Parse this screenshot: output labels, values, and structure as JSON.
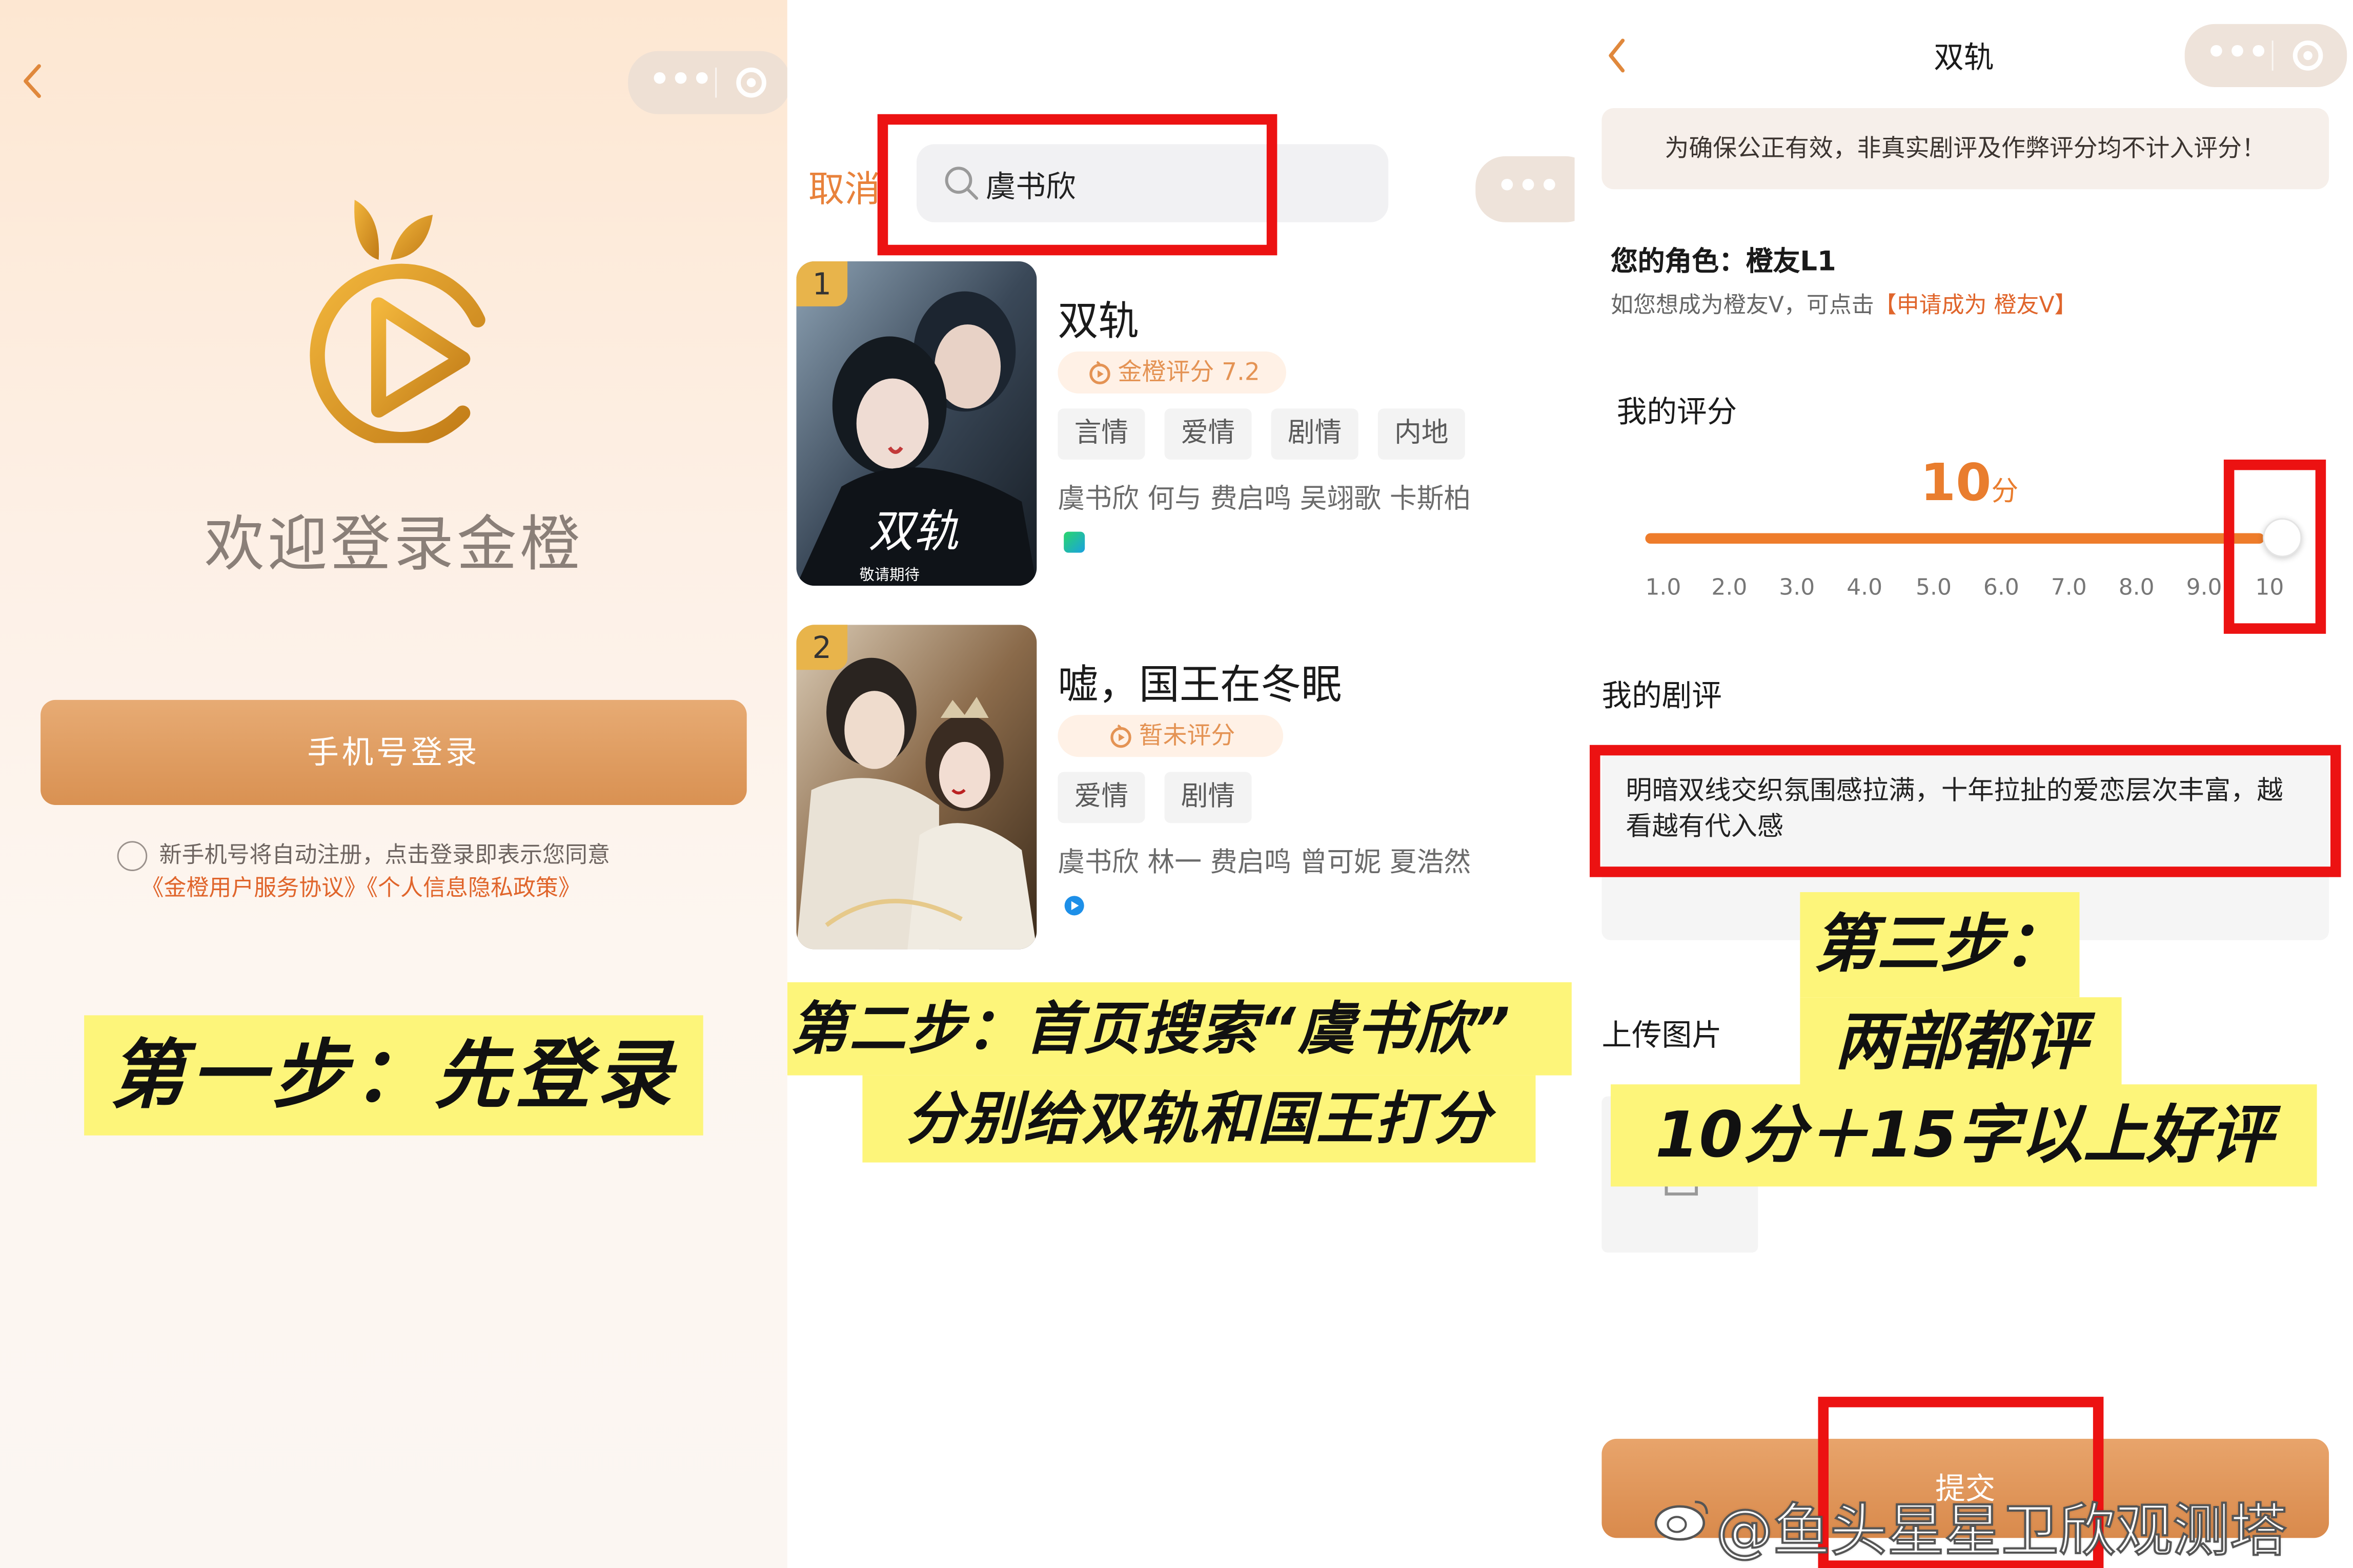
{
  "step1": {
    "welcome": "欢迎登录金橙",
    "phone_login": "手机号登录",
    "agree_line1": "新手机号将自动注册，点击登录即表示您同意",
    "agree_line2": "《金橙用户服务协议》《个人信息隐私政策》",
    "caption": "第一步：先登录"
  },
  "step2": {
    "cancel": "取消",
    "search_value": "虞书欣",
    "results": [
      {
        "rank": "1",
        "title": "双轨",
        "score": "金橙评分 7.2",
        "tags": [
          "言情",
          "爱情",
          "剧情",
          "内地"
        ],
        "cast": "虞书欣 何与 费启鸣 吴翊歌 卡斯柏",
        "poster_text": "双轨",
        "poster_sub": "敬请期待"
      },
      {
        "rank": "2",
        "title": "嘘，国王在冬眠",
        "score": "暂未评分",
        "tags": [
          "爱情",
          "剧情"
        ],
        "cast": "虞书欣 林一 费启鸣 曾可妮 夏浩然"
      }
    ],
    "caption_line1": "第二步：首页搜索“虞书欣”",
    "caption_line2": "分别给双轨和国王打分"
  },
  "step3": {
    "nav_title": "双轨",
    "notice": "为确保公正有效，非真实剧评及作弊评分均不计入评分！",
    "role": "您的角色：橙友L1",
    "role_sub_prefix": "如您想成为橙友V，可点击",
    "role_sub_link": "【申请成为 橙友V】",
    "my_score_label": "我的评分",
    "score_value": "10",
    "score_unit": "分",
    "ticks": [
      "1.0",
      "2.0",
      "3.0",
      "4.0",
      "5.0",
      "6.0",
      "7.0",
      "8.0",
      "9.0",
      "10"
    ],
    "my_review_label": "我的剧评",
    "review_text": "明暗双线交织氛围感拉满，十年拉扯的爱恋层次丰富，越看越有代入感",
    "upload_label": "上传图片",
    "submit": "提交",
    "caption_line1": "第三步：",
    "caption_line2": "两部都评",
    "caption_line3": "10分＋15字以上好评",
    "watermark": "@鱼头星星卫欣观测塔"
  },
  "colors": {
    "brand_orange": "#e97d2e",
    "highlight_yellow": "#fdf57a",
    "annotation_red": "#ec1212"
  }
}
